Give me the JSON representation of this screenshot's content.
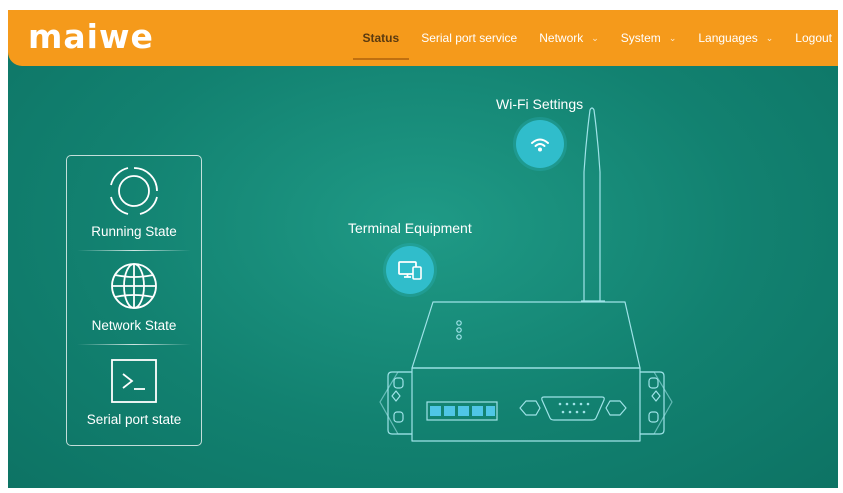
{
  "brand": {
    "logo_text": "maiwe"
  },
  "nav": {
    "items": [
      {
        "label": "Status",
        "active": true,
        "dropdown": false
      },
      {
        "label": "Serial port service",
        "active": false,
        "dropdown": false
      },
      {
        "label": "Network",
        "active": false,
        "dropdown": true
      },
      {
        "label": "System",
        "active": false,
        "dropdown": true
      },
      {
        "label": "Languages",
        "active": false,
        "dropdown": true
      },
      {
        "label": "Logout",
        "active": false,
        "dropdown": false
      }
    ]
  },
  "sidebar": {
    "items": [
      {
        "label": "Running State",
        "icon": "running-state-icon"
      },
      {
        "label": "Network State",
        "icon": "globe-icon"
      },
      {
        "label": "Serial port state",
        "icon": "terminal-icon"
      }
    ]
  },
  "hotspots": {
    "wifi": {
      "label": "Wi-Fi Settings",
      "icon": "wifi-icon"
    },
    "terminal": {
      "label": "Terminal Equipment",
      "icon": "devices-icon"
    }
  },
  "colors": {
    "topbar": "#f59a1b",
    "background": "#128170",
    "hotspot": "#30bdcb",
    "line": "#9fe3e8"
  }
}
